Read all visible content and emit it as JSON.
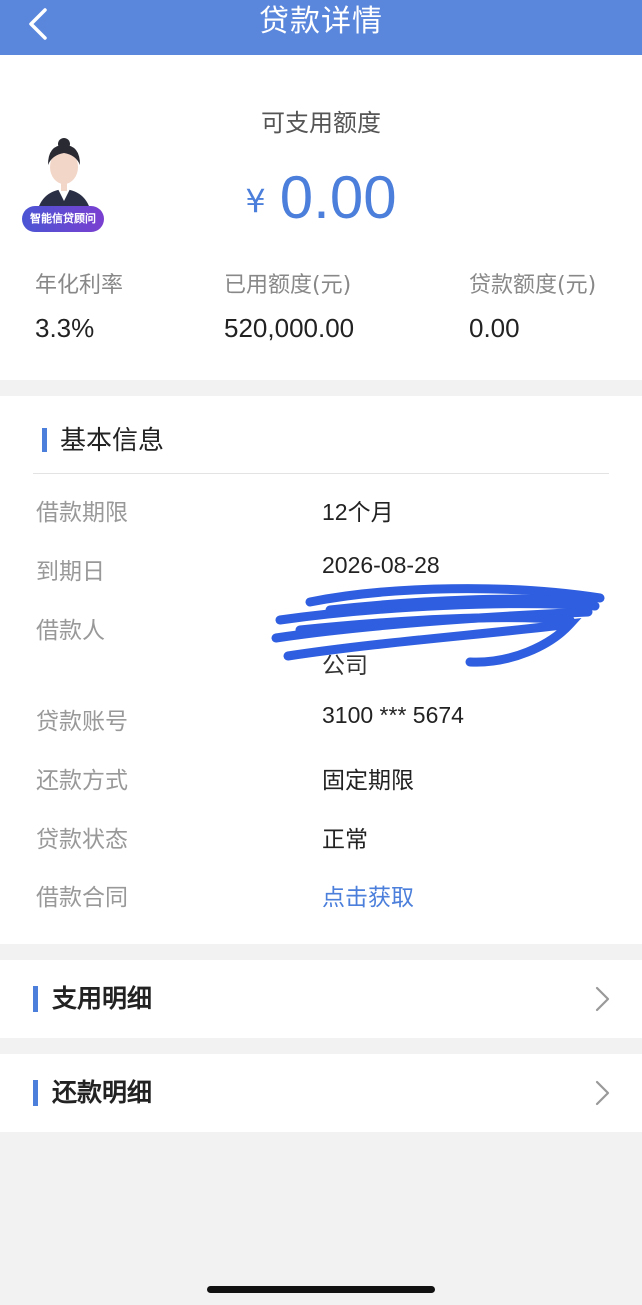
{
  "header": {
    "title": "贷款详情"
  },
  "summary": {
    "available_label": "可支用额度",
    "currency_symbol": "¥",
    "available_amount": "0.00",
    "avatar_badge": "智能信贷顾问",
    "stats": [
      {
        "label": "年化利率",
        "value": "3.3%"
      },
      {
        "label": "已用额度(元)",
        "value": "520,000.00"
      },
      {
        "label": "贷款额度(元)",
        "value": "0.00"
      }
    ]
  },
  "basic_info": {
    "title": "基本信息",
    "rows": [
      {
        "label": "借款期限",
        "value": "12个月"
      },
      {
        "label": "到期日",
        "value": "2026-08-28"
      },
      {
        "label": "借款人",
        "value": "公司"
      },
      {
        "label": "贷款账号",
        "value": "3100 *** 5674"
      },
      {
        "label": "还款方式",
        "value": "固定期限"
      },
      {
        "label": "贷款状态",
        "value": "正常"
      },
      {
        "label": "借款合同",
        "value": "点击获取"
      }
    ]
  },
  "links": {
    "drawdown_detail": "支用明细",
    "repayment_detail": "还款明细"
  },
  "colors": {
    "accent": "#4b7fdb",
    "header_bg": "#5a86dc",
    "redaction": "#2f5fe0"
  }
}
